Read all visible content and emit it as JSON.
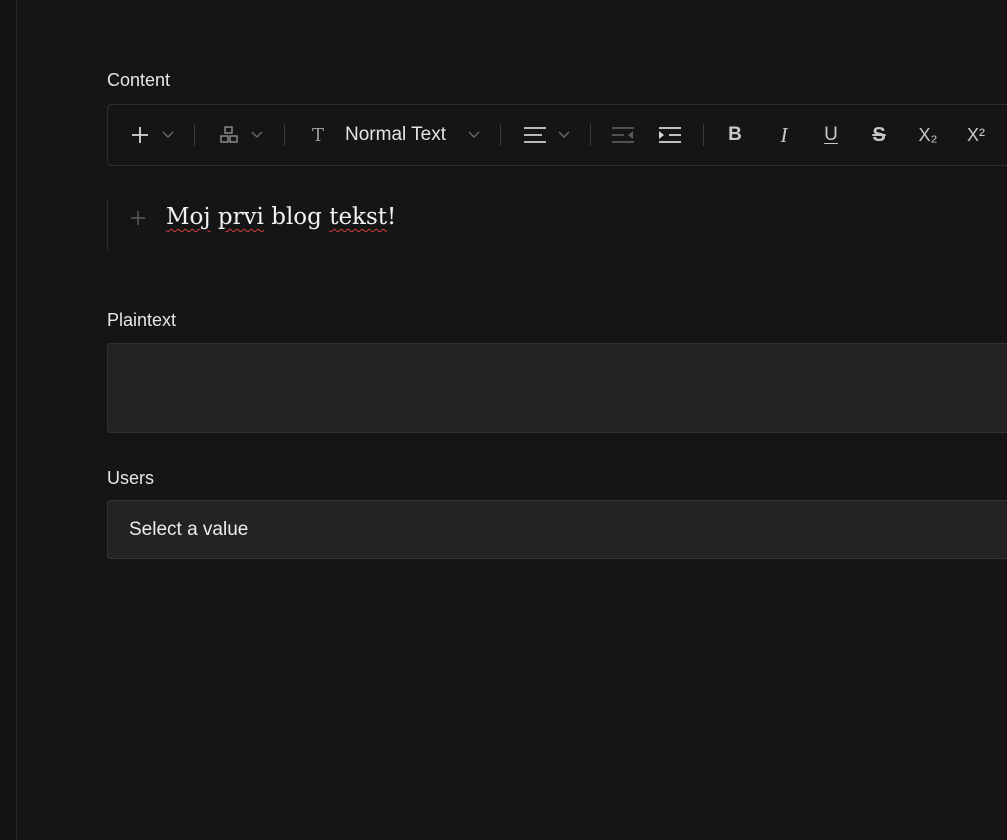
{
  "fields": {
    "content_label": "Content",
    "plaintext_label": "Plaintext",
    "users_label": "Users"
  },
  "toolbar": {
    "heading_style": "Normal Text",
    "text_style_glyph": "T",
    "bold": "B",
    "italic": "I",
    "underline": "U",
    "strike": "S",
    "subscript": "X₂",
    "superscript": "X²",
    "icons": [
      "plus-icon",
      "blocks-icon",
      "text-style-icon",
      "align-left-icon",
      "outdent-icon",
      "indent-icon"
    ]
  },
  "editor": {
    "words": [
      "Moj",
      " ",
      "prvi",
      " blog ",
      "tekst",
      "!"
    ]
  },
  "plaintext": {
    "value": ""
  },
  "users": {
    "placeholder": "Select a value"
  },
  "colors": {
    "background": "#151515",
    "input_background": "#232323",
    "border": "#343434",
    "spellcheck": "#d43d3d"
  }
}
